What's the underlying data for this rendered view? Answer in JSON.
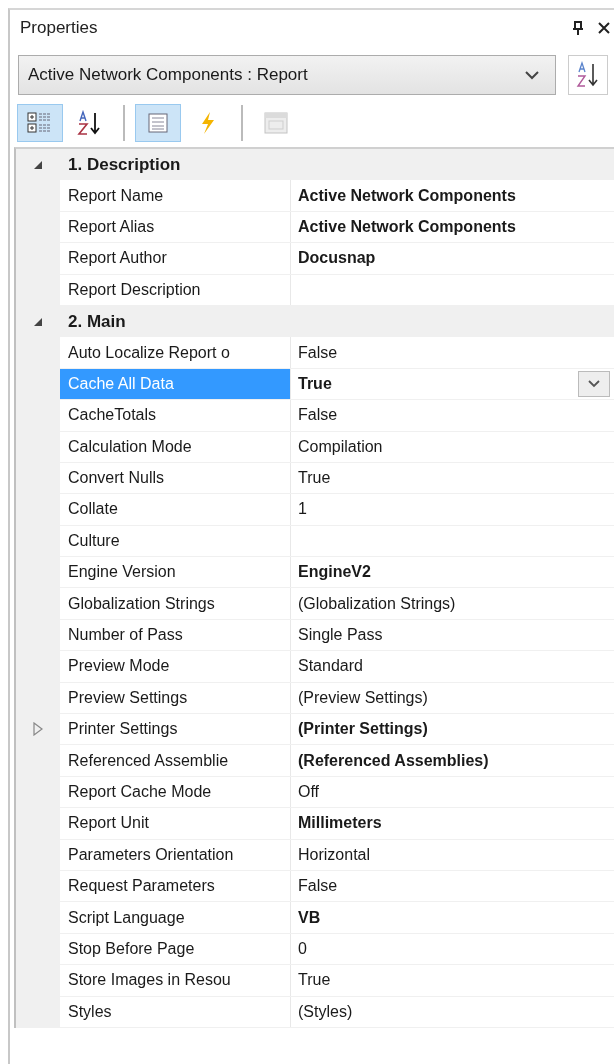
{
  "panel": {
    "title": "Properties"
  },
  "object_selector": {
    "value": "Active Network Components : Report"
  },
  "toolbar": [
    {
      "kind": "categorized",
      "selected": true,
      "disabled": false
    },
    {
      "kind": "alphabetical",
      "selected": false,
      "disabled": false
    },
    {
      "kind": "separator"
    },
    {
      "kind": "properties",
      "selected": true,
      "disabled": false
    },
    {
      "kind": "events",
      "selected": false,
      "disabled": false
    },
    {
      "kind": "separator"
    },
    {
      "kind": "pages",
      "selected": false,
      "disabled": true
    }
  ],
  "categories": [
    {
      "name": "1. Description",
      "expanded": true,
      "properties": [
        {
          "name": "Report Name",
          "value": "Active Network Components",
          "bold": true,
          "selected": false,
          "kind": "plain"
        },
        {
          "name": "Report Alias",
          "value": "Active Network Components",
          "bold": true,
          "selected": false,
          "kind": "plain"
        },
        {
          "name": "Report Author",
          "value": "Docusnap",
          "bold": true,
          "selected": false,
          "kind": "plain"
        },
        {
          "name": "Report Description",
          "selected": false,
          "kind": "plain"
        }
      ]
    },
    {
      "name": "2. Main",
      "expanded": true,
      "properties": [
        {
          "name": "Auto Localize Report o",
          "value": "False",
          "bold": false,
          "selected": false,
          "kind": "plain"
        },
        {
          "name": "Cache All Data",
          "value": "True",
          "bold": true,
          "selected": true,
          "kind": "plain"
        },
        {
          "name": "CacheTotals",
          "value": "False",
          "bold": false,
          "selected": false,
          "kind": "plain"
        },
        {
          "name": "Calculation Mode",
          "value": "Compilation",
          "bold": false,
          "selected": false,
          "kind": "plain"
        },
        {
          "name": "Convert Nulls",
          "value": "True",
          "bold": false,
          "selected": false,
          "kind": "plain"
        },
        {
          "name": "Collate",
          "value": "1",
          "bold": false,
          "selected": false,
          "kind": "plain"
        },
        {
          "name": "Culture",
          "selected": false,
          "kind": "plain"
        },
        {
          "name": "Engine Version",
          "value": "EngineV2",
          "bold": true,
          "selected": false,
          "kind": "plain"
        },
        {
          "name": "Globalization Strings",
          "value": "(Globalization Strings)",
          "bold": false,
          "selected": false,
          "kind": "plain"
        },
        {
          "name": "Number of Pass",
          "value": "Single Pass",
          "bold": false,
          "selected": false,
          "kind": "plain"
        },
        {
          "name": "Preview Mode",
          "value": "Standard",
          "bold": false,
          "selected": false,
          "kind": "plain"
        },
        {
          "name": "Preview Settings",
          "value": "(Preview Settings)",
          "bold": false,
          "selected": false,
          "kind": "plain"
        },
        {
          "name": "Printer Settings",
          "value": "(Printer Settings)",
          "bold": true,
          "selected": false,
          "kind": "expandable",
          "expanded": false
        },
        {
          "name": "Referenced Assemblie",
          "value": "(Referenced Assemblies)",
          "bold": true,
          "selected": false,
          "kind": "plain"
        },
        {
          "name": "Report Cache Mode",
          "value": "Off",
          "bold": false,
          "selected": false,
          "kind": "plain"
        },
        {
          "name": "Report Unit",
          "value": "Millimeters",
          "bold": true,
          "selected": false,
          "kind": "plain"
        },
        {
          "name": "Parameters Orientation",
          "value": "Horizontal",
          "bold": false,
          "selected": false,
          "kind": "plain"
        },
        {
          "name": "Request Parameters",
          "value": "False",
          "bold": false,
          "selected": false,
          "kind": "plain"
        },
        {
          "name": "Script Language",
          "value": "VB",
          "bold": true,
          "selected": false,
          "kind": "plain"
        },
        {
          "name": "Stop Before Page",
          "value": "0",
          "bold": false,
          "selected": false,
          "kind": "plain"
        },
        {
          "name": "Store Images in Resou",
          "value": "True",
          "bold": false,
          "selected": false,
          "kind": "plain"
        },
        {
          "name": "Styles",
          "value": "(Styles)",
          "bold": false,
          "selected": false,
          "kind": "plain"
        }
      ]
    }
  ]
}
